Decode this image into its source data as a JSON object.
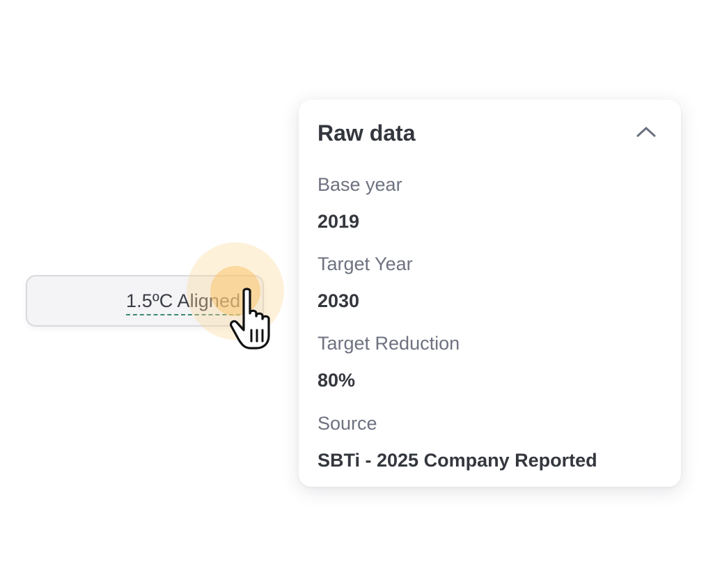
{
  "chip": {
    "label": "1.5ºC Aligned"
  },
  "panel": {
    "title": "Raw data",
    "fields": [
      {
        "label": "Base year",
        "value": "2019"
      },
      {
        "label": "Target Year",
        "value": "2030"
      },
      {
        "label": "Target Reduction",
        "value": "80%"
      },
      {
        "label": "Source",
        "value": "SBTi - 2025 Company Reported"
      }
    ]
  },
  "icons": {
    "collapse": "chevron-up-icon",
    "cursor": "hand-pointer-icon"
  },
  "colors": {
    "underline": "#3f8a6b",
    "highlight": "#f9c46e"
  }
}
